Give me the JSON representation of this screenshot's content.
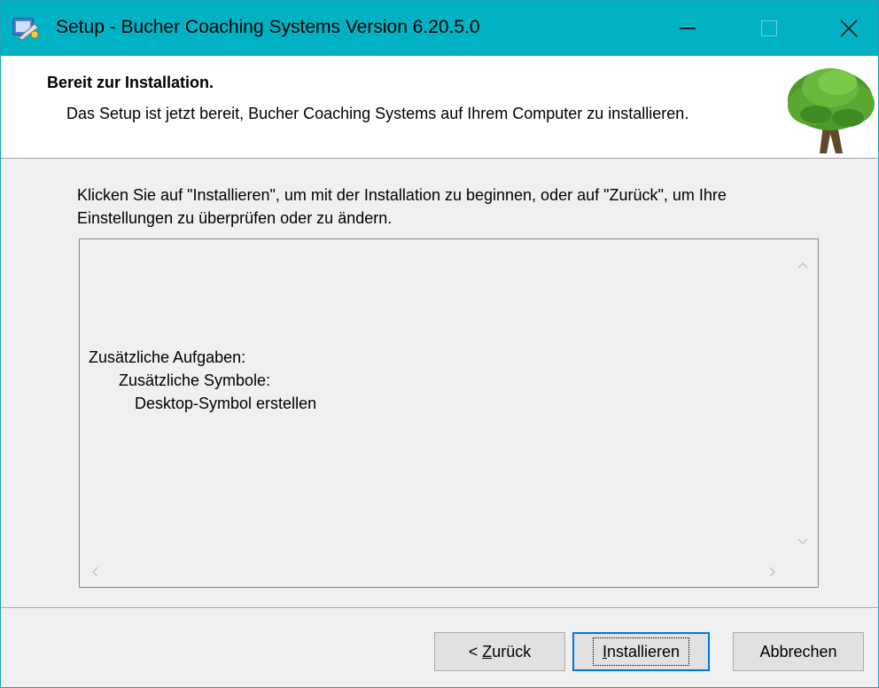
{
  "window": {
    "title": "Setup - Bucher Coaching Systems Version 6.20.5.0"
  },
  "header": {
    "title": "Bereit zur Installation.",
    "description": "Das Setup ist jetzt bereit, Bucher Coaching Systems auf Ihrem Computer zu installieren."
  },
  "body": {
    "intro": "Klicken Sie auf \"Installieren\", um mit der Installation zu beginnen, oder auf \"Zurück\", um Ihre Einstellungen zu überprüfen oder zu ändern.",
    "memo": {
      "lines": [
        "Zusätzliche Aufgaben:",
        "Zusätzliche Symbole:",
        "Desktop-Symbol erstellen"
      ]
    }
  },
  "buttons": {
    "back_prefix": "< ",
    "back_accel": "Z",
    "back_rest": "urück",
    "install_accel": "I",
    "install_rest": "nstallieren",
    "cancel": "Abbrechen"
  },
  "colors": {
    "titlebar": "#00b2c3",
    "accent": "#0078d7"
  }
}
